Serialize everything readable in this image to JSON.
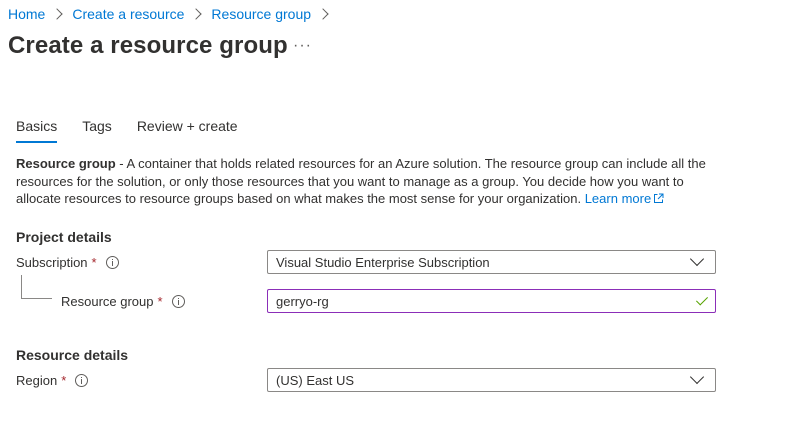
{
  "breadcrumb": {
    "items": [
      "Home",
      "Create a resource",
      "Resource group"
    ]
  },
  "page": {
    "title": "Create a resource group",
    "more_label": "···"
  },
  "tabs": [
    {
      "label": "Basics",
      "active": true
    },
    {
      "label": "Tags",
      "active": false
    },
    {
      "label": "Review + create",
      "active": false
    }
  ],
  "description": {
    "term": "Resource group",
    "text": " - A container that holds related resources for an Azure solution. The resource group can include all the resources for the solution, or only those resources that you want to manage as a group. You decide how you want to allocate resources to resource groups based on what makes the most sense for your organization. ",
    "link": "Learn more"
  },
  "project_details": {
    "heading": "Project details",
    "subscription": {
      "label": "Subscription",
      "required_marker": "*",
      "value": "Visual Studio Enterprise Subscription"
    },
    "resource_group": {
      "label": "Resource group",
      "required_marker": "*",
      "value": "gerryo-rg"
    }
  },
  "resource_details": {
    "heading": "Resource details",
    "region": {
      "label": "Region",
      "required_marker": "*",
      "value": "(US) East US"
    }
  },
  "colors": {
    "link": "#0078d4",
    "required": "#a4262c",
    "focus_border": "#8b2eb8",
    "valid_check": "#57a300",
    "text": "#323130"
  },
  "icons": {
    "breadcrumb_separator": "chevron-right-icon",
    "info": "info-icon",
    "dropdown": "chevron-down-icon",
    "valid": "checkmark-icon",
    "external_link": "external-link-icon"
  }
}
